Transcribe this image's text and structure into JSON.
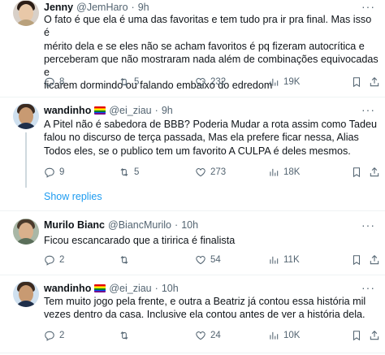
{
  "tweets": [
    {
      "name": "Jenny",
      "handle": "@JemHaro",
      "time": "9h",
      "lines": [
        "O fato é que ela é uma das favoritas e tem tudo pra ir pra final. Mas isso é",
        "mérito dela e se eles não se acham favoritos é pq fizeram autocrítica e",
        "perceberam que não mostraram nada além de combinações equivocadas e",
        "ficarem dormindo ou falando embaixo do edredom"
      ],
      "replies": "8",
      "retweets": "5",
      "likes": "232",
      "views": "19K"
    },
    {
      "name": "wandinho",
      "handle": "@ei_ziau",
      "time": "9h",
      "lines": [
        "A Pitel não é sabedora de BBB? Poderia Mudar a rota assim como Tadeu",
        "falou no discurso de terça passada, Mas ela prefere ficar nessa, Alias",
        "Todos eles, se o publico tem um favorito A CULPA é deles mesmos."
      ],
      "replies": "9",
      "retweets": "5",
      "likes": "273",
      "views": "18K"
    },
    {
      "name": "Murilo Bianc",
      "handle": "@BiancMurilo",
      "time": "10h",
      "lines": [
        "Ficou escancarado que a tiririca é finalista"
      ],
      "replies": "2",
      "retweets": "",
      "likes": "54",
      "views": "11K"
    },
    {
      "name": "wandinho",
      "handle": "@ei_ziau",
      "time": "10h",
      "lines": [
        "Tem muito jogo pela frente, e outra a Beatriz já contou essa história mil",
        "vezes dentro da casa. Inclusive ela contou antes de ver a história dela."
      ],
      "replies": "2",
      "retweets": "",
      "likes": "24",
      "views": "10K"
    }
  ],
  "show_replies": "Show replies",
  "colors": {
    "link": "#1d9bf0",
    "muted": "#536471",
    "thread_line": "#cfd9de",
    "pride_flag": [
      "#e40303",
      "#ff8c00",
      "#ffed00",
      "#008026",
      "#004dff",
      "#750787"
    ]
  },
  "icons": [
    "reply-icon",
    "retweet-icon",
    "like-icon",
    "views-icon",
    "bookmark-icon",
    "share-icon",
    "more-icon",
    "pride-flag-icon"
  ]
}
